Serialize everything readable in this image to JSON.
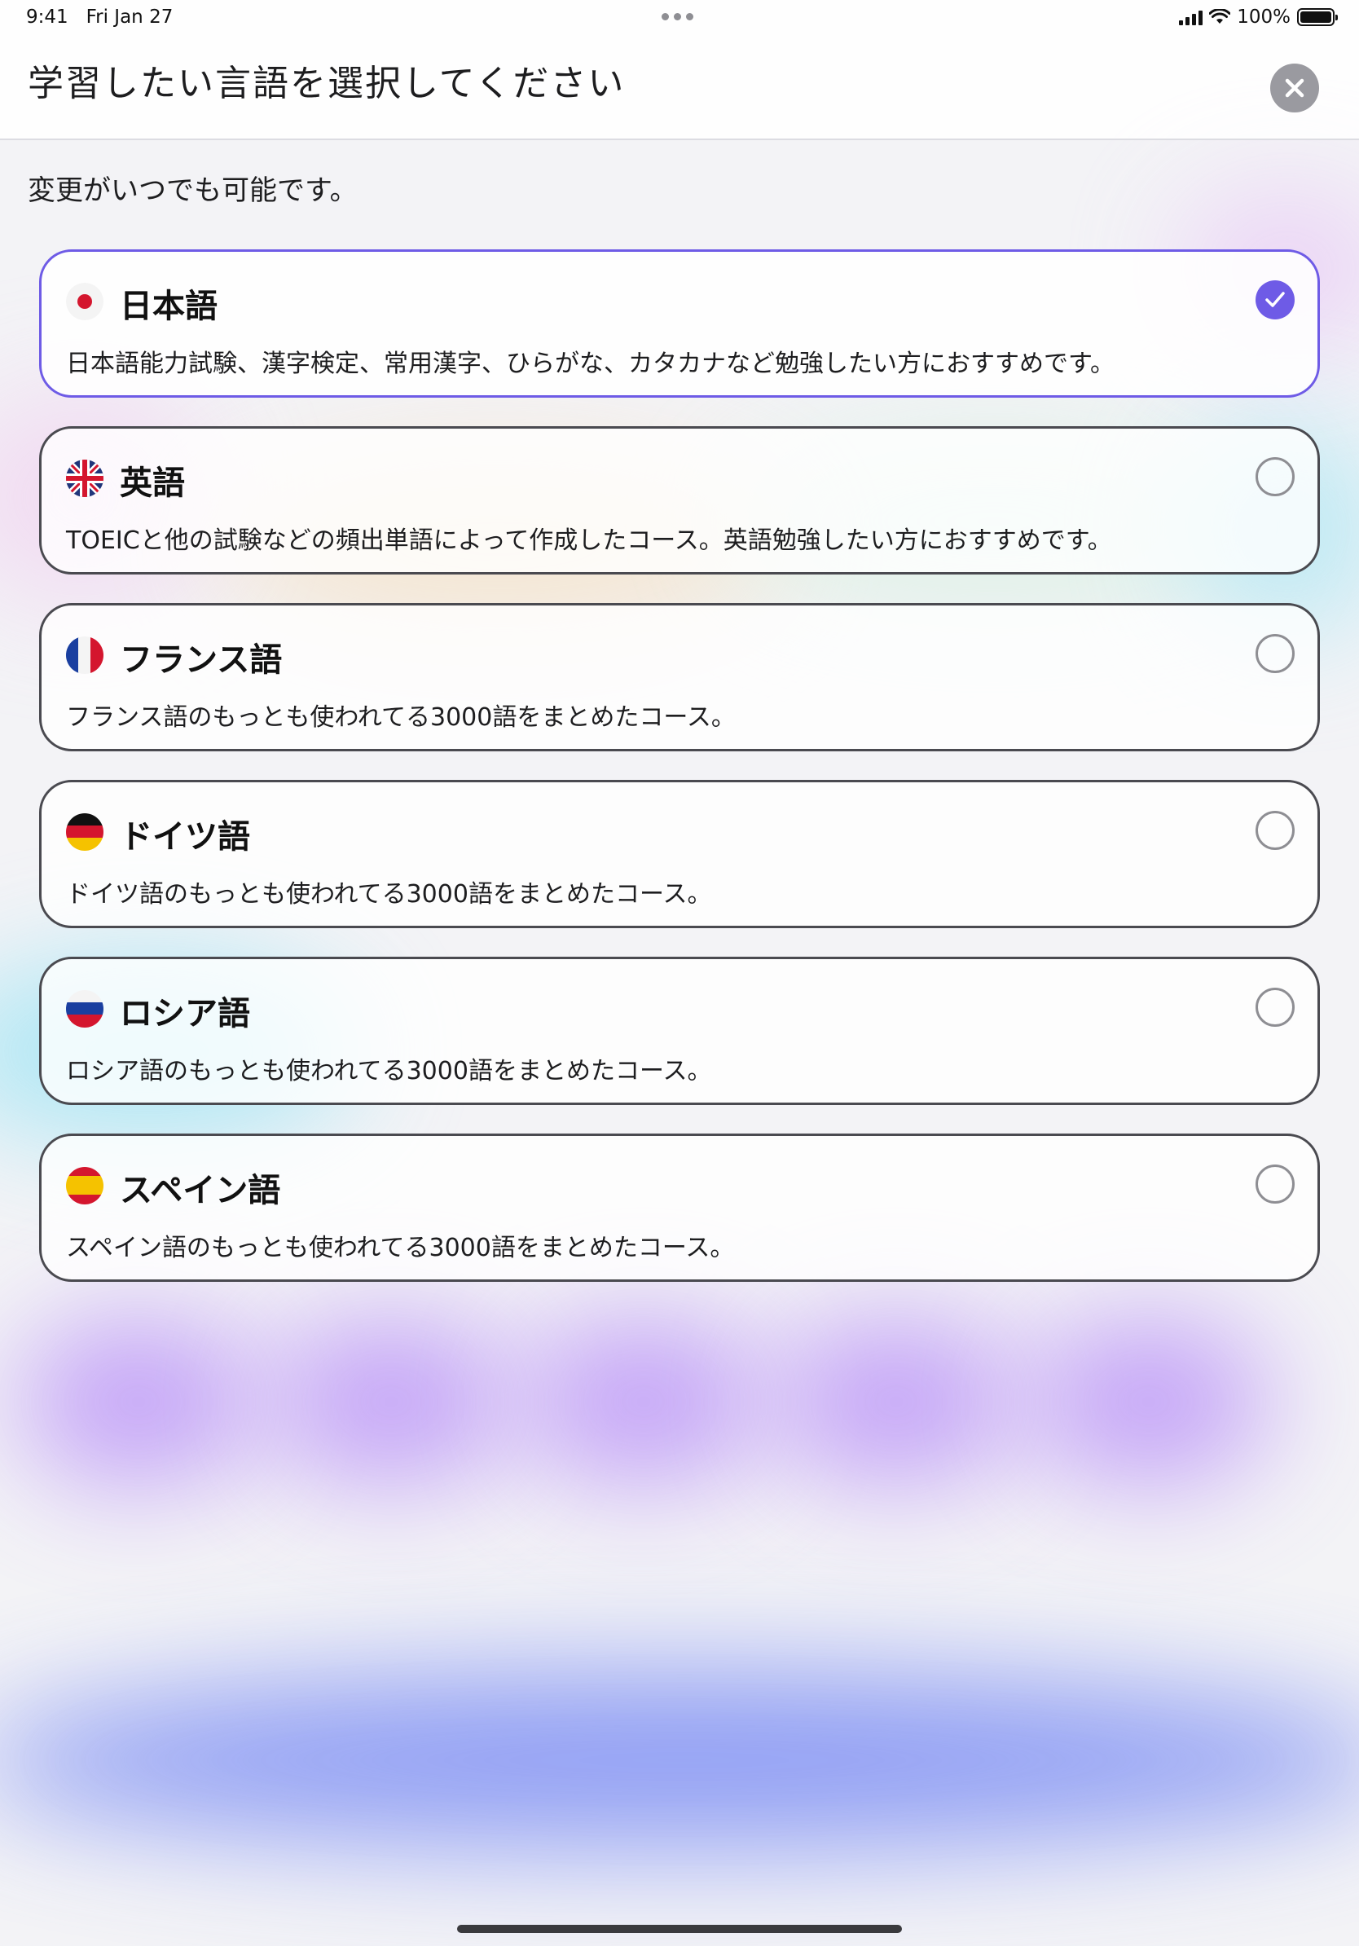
{
  "status_bar": {
    "time": "9:41",
    "date": "Fri Jan 27",
    "battery": "100%"
  },
  "header": {
    "title": "学習したい言語を選択してください"
  },
  "subtitle": "変更がいつでも可能です。",
  "languages": [
    {
      "flag": "japan-flag-icon",
      "name": "日本語",
      "description": "日本語能力試験、漢字検定、常用漢字、ひらがな、カタカナなど勉強したい方におすすめです。",
      "selected": true
    },
    {
      "flag": "uk-flag-icon",
      "name": "英語",
      "description": "TOEICと他の試験などの頻出単語によって作成したコース。英語勉強したい方におすすめです。",
      "selected": false
    },
    {
      "flag": "france-flag-icon",
      "name": "フランス語",
      "description": "フランス語のもっとも使われてる3000語をまとめたコース。",
      "selected": false
    },
    {
      "flag": "germany-flag-icon",
      "name": "ドイツ語",
      "description": "ドイツ語のもっとも使われてる3000語をまとめたコース。",
      "selected": false
    },
    {
      "flag": "russia-flag-icon",
      "name": "ロシア語",
      "description": "ロシア語のもっとも使われてる3000語をまとめたコース。",
      "selected": false
    },
    {
      "flag": "spain-flag-icon",
      "name": "スペイン語",
      "description": "スペイン語のもっとも使われてる3000語をまとめたコース。",
      "selected": false
    }
  ],
  "colors": {
    "accent": "#6e5be6",
    "card_border": "#4a4a50",
    "close_button": "#9a9aa0"
  }
}
